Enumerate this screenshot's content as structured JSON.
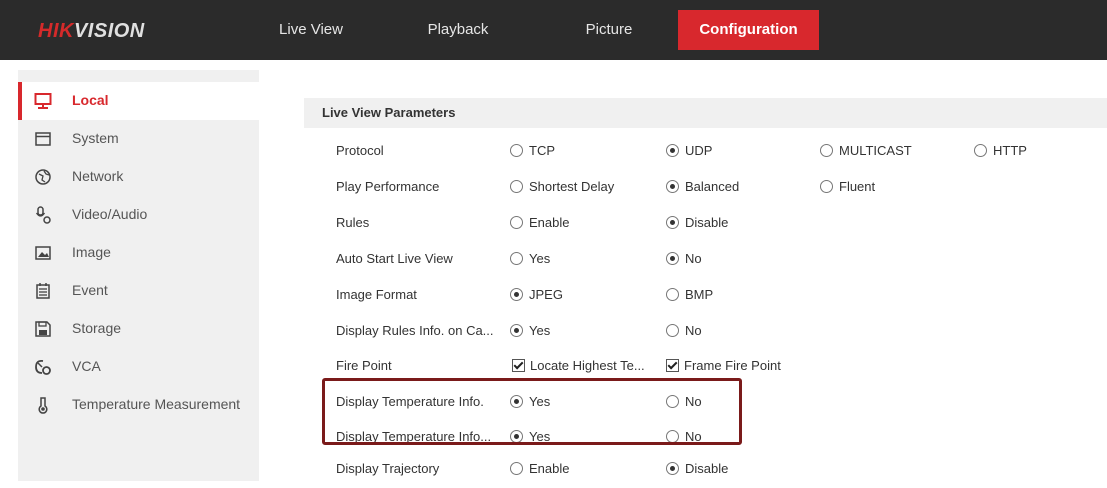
{
  "header": {
    "logo_red": "HIK",
    "logo_rest": "VISION",
    "tabs": [
      {
        "label": "Live View"
      },
      {
        "label": "Playback"
      },
      {
        "label": "Picture"
      },
      {
        "label": "Configuration"
      }
    ],
    "active_tab": "Configuration"
  },
  "sidebar": {
    "items": [
      {
        "label": "Local",
        "icon": "monitor-icon",
        "active": true
      },
      {
        "label": "System",
        "icon": "system-icon"
      },
      {
        "label": "Network",
        "icon": "globe-icon"
      },
      {
        "label": "Video/Audio",
        "icon": "microphone-icon"
      },
      {
        "label": "Image",
        "icon": "image-icon"
      },
      {
        "label": "Event",
        "icon": "calendar-icon"
      },
      {
        "label": "Storage",
        "icon": "floppy-icon"
      },
      {
        "label": "VCA",
        "icon": "vca-icon"
      },
      {
        "label": "Temperature Measurement",
        "icon": "thermometer-icon"
      }
    ]
  },
  "main": {
    "section_title": "Live View Parameters",
    "rows": [
      {
        "label": "Protocol",
        "options": [
          {
            "label": "TCP",
            "selected": false
          },
          {
            "label": "UDP",
            "selected": true
          },
          {
            "label": "MULTICAST",
            "selected": false
          },
          {
            "label": "HTTP",
            "selected": false
          }
        ]
      },
      {
        "label": "Play Performance",
        "options": [
          {
            "label": "Shortest Delay",
            "selected": false
          },
          {
            "label": "Balanced",
            "selected": true
          },
          {
            "label": "Fluent",
            "selected": false
          }
        ]
      },
      {
        "label": "Rules",
        "options": [
          {
            "label": "Enable",
            "selected": false
          },
          {
            "label": "Disable",
            "selected": true
          }
        ]
      },
      {
        "label": "Auto Start Live View",
        "options": [
          {
            "label": "Yes",
            "selected": false
          },
          {
            "label": "No",
            "selected": true
          }
        ]
      },
      {
        "label": "Image Format",
        "options": [
          {
            "label": "JPEG",
            "selected": true
          },
          {
            "label": "BMP",
            "selected": false
          }
        ]
      },
      {
        "label": "Display Rules Info. on Ca...",
        "options": [
          {
            "label": "Yes",
            "selected": true
          },
          {
            "label": "No",
            "selected": false
          }
        ]
      },
      {
        "label": "Fire Point",
        "checkboxes": [
          {
            "label": "Locate Highest Te...",
            "checked": true
          },
          {
            "label": "Frame Fire Point",
            "checked": true
          }
        ]
      },
      {
        "label": "Display Temperature Info.",
        "options": [
          {
            "label": "Yes",
            "selected": true
          },
          {
            "label": "No",
            "selected": false
          }
        ]
      },
      {
        "label": "Display Temperature Info...",
        "options": [
          {
            "label": "Yes",
            "selected": true
          },
          {
            "label": "No",
            "selected": false
          }
        ]
      },
      {
        "label": "Display Trajectory",
        "options": [
          {
            "label": "Enable",
            "selected": false
          },
          {
            "label": "Disable",
            "selected": true
          }
        ]
      }
    ]
  },
  "colors": {
    "accent": "#d8282d",
    "topbar": "#2b2b2b",
    "sidebar": "#f0f0f0",
    "highlight": "#7a1a1a"
  }
}
